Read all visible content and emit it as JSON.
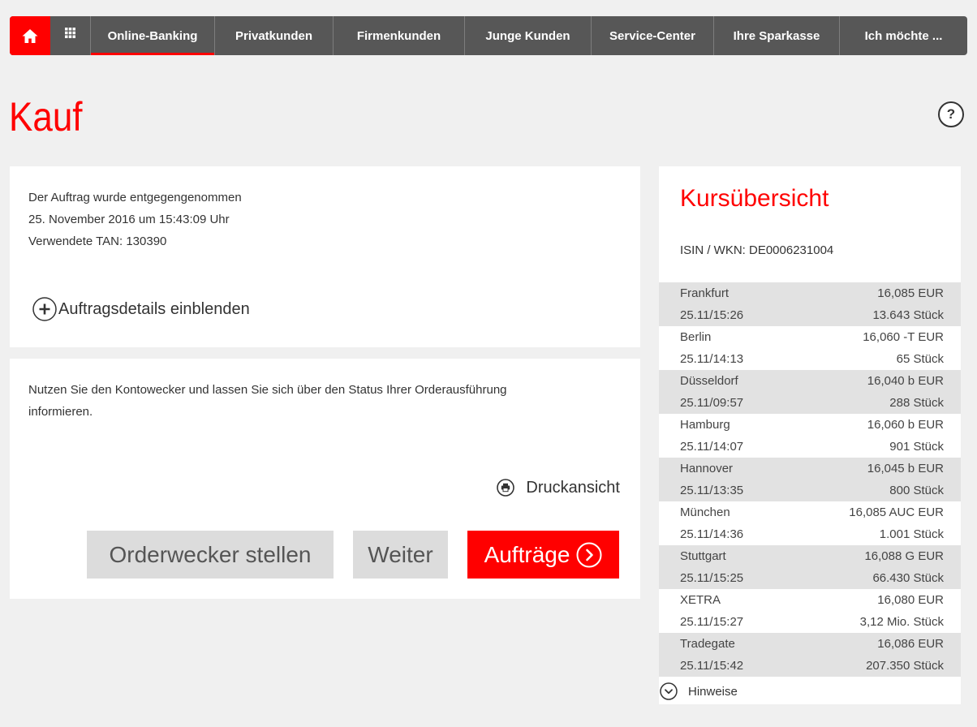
{
  "nav": {
    "home_icon": "home-icon",
    "apps_icon": "grid-icon",
    "items": [
      {
        "label": "Online-Banking",
        "active": true
      },
      {
        "label": "Privatkunden",
        "active": false
      },
      {
        "label": "Firmenkunden",
        "active": false
      },
      {
        "label": "Junge Kunden",
        "active": false
      },
      {
        "label": "Service-Center",
        "active": false
      },
      {
        "label": "Ihre Sparkasse",
        "active": false
      },
      {
        "label": "Ich möchte ...",
        "active": false
      }
    ]
  },
  "page": {
    "title": "Kauf",
    "help_icon": "help-icon",
    "help_label": "?"
  },
  "confirmation": {
    "lines": [
      "Der Auftrag wurde entgegengenommen",
      "25. November 2016 um 15:43:09 Uhr",
      "Verwendete TAN: 130390"
    ],
    "details_icon": "plus-circle-icon",
    "details_label": "Auftragsdetails einblenden"
  },
  "order_alert": {
    "lines": [
      "Nutzen Sie den Kontowecker und lassen Sie sich über den Status Ihrer Orderausführung",
      "informieren."
    ],
    "print_icon": "printer-icon",
    "print_label": "Druckansicht",
    "buttons": {
      "orderwecker_label": "Orderwecker stellen",
      "weiter_label": "Weiter",
      "auftraege_label": "Aufträge",
      "auftraege_icon": "chevron-right-circle-icon"
    }
  },
  "quotes": {
    "title": "Kursübersicht",
    "isin_line": "ISIN / WKN: DE0006231004",
    "rows": [
      {
        "exchange": "Frankfurt",
        "price": "16,085 EUR",
        "time": "25.11/15:26",
        "volume": "13.643 Stück"
      },
      {
        "exchange": "Berlin",
        "price": "16,060 -T EUR",
        "time": "25.11/14:13",
        "volume": "65 Stück"
      },
      {
        "exchange": "Düsseldorf",
        "price": "16,040 b EUR",
        "time": "25.11/09:57",
        "volume": "288 Stück"
      },
      {
        "exchange": "Hamburg",
        "price": "16,060 b EUR",
        "time": "25.11/14:07",
        "volume": "901 Stück"
      },
      {
        "exchange": "Hannover",
        "price": "16,045 b EUR",
        "time": "25.11/13:35",
        "volume": "800 Stück"
      },
      {
        "exchange": "München",
        "price": "16,085 AUC EUR",
        "time": "25.11/14:36",
        "volume": "1.001 Stück"
      },
      {
        "exchange": "Stuttgart",
        "price": "16,088 G EUR",
        "time": "25.11/15:25",
        "volume": "66.430 Stück"
      },
      {
        "exchange": "XETRA",
        "price": "16,080 EUR",
        "time": "25.11/15:27",
        "volume": "3,12 Mio. Stück"
      },
      {
        "exchange": "Tradegate",
        "price": "16,086 EUR",
        "time": "25.11/15:42",
        "volume": "207.350 Stück"
      }
    ],
    "hint_icon": "chevron-down-circle-icon",
    "hint_label": "Hinweise"
  },
  "colors": {
    "brand_red": "#ff0000",
    "nav_background": "#575757",
    "page_background": "#f0f0f0",
    "row_stripe": "#e2e2e2",
    "button_gray": "#dcdcdc"
  }
}
